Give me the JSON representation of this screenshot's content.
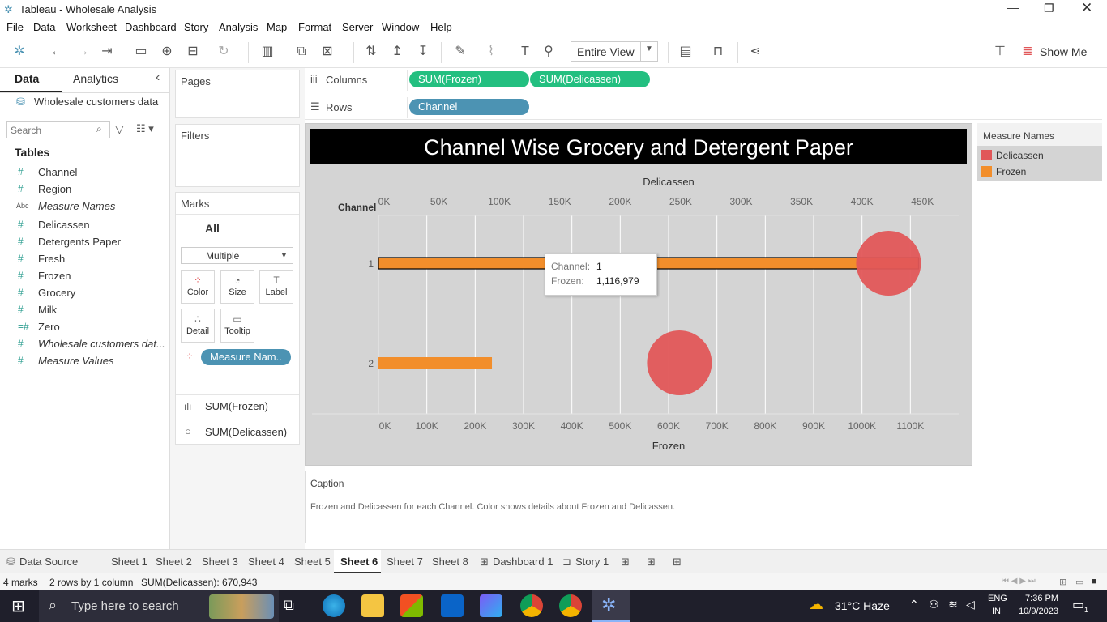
{
  "app": {
    "title": "Tableau - Wholesale Analysis"
  },
  "menu": [
    "File",
    "Data",
    "Worksheet",
    "Dashboard",
    "Story",
    "Analysis",
    "Map",
    "Format",
    "Server",
    "Window",
    "Help"
  ],
  "toolbar": {
    "view_mode": "Entire View",
    "show_me": "Show Me"
  },
  "left_pane": {
    "tab_data": "Data",
    "tab_analytics": "Analytics",
    "datasource": "Wholesale customers data",
    "search_placeholder": "Search",
    "tables_header": "Tables",
    "fields": [
      {
        "icon": "#",
        "name": "Channel"
      },
      {
        "icon": "#",
        "name": "Region"
      },
      {
        "icon": "Abc",
        "name": "Measure Names"
      },
      {
        "icon": "#",
        "name": "Delicassen"
      },
      {
        "icon": "#",
        "name": "Detergents Paper"
      },
      {
        "icon": "#",
        "name": "Fresh"
      },
      {
        "icon": "#",
        "name": "Frozen"
      },
      {
        "icon": "#",
        "name": "Grocery"
      },
      {
        "icon": "#",
        "name": "Milk"
      },
      {
        "icon": "=#",
        "name": "Zero"
      },
      {
        "icon": "#",
        "name": "Wholesale customers dat..."
      },
      {
        "icon": "#",
        "name": "Measure Values"
      }
    ]
  },
  "cards": {
    "pages": "Pages",
    "filters": "Filters",
    "marks": "Marks",
    "marks_all": "All",
    "mark_type": "Multiple",
    "buttons": {
      "color": "Color",
      "size": "Size",
      "label": "Label",
      "detail": "Detail",
      "tooltip": "Tooltip"
    },
    "measure_pill": "Measure Nam..",
    "marks_frozen": "SUM(Frozen)",
    "marks_delicassen": "SUM(Delicassen)"
  },
  "shelves": {
    "columns_label": "Columns",
    "rows_label": "Rows",
    "columns_pills": [
      "SUM(Frozen)",
      "SUM(Delicassen)"
    ],
    "rows_pills": [
      "Channel"
    ]
  },
  "viz": {
    "title": "Channel Wise Grocery and Detergent Paper",
    "row_header": "Channel",
    "top_axis_title": "Delicassen",
    "bottom_axis_title": "Frozen",
    "tooltip": {
      "channel_label": "Channel:",
      "channel_value": "1",
      "frozen_label": "Frozen:",
      "frozen_value": "1,116,979"
    }
  },
  "chart_data": {
    "type": "bar",
    "title": "Channel Wise Grocery and Detergent Paper",
    "categories": [
      "1",
      "2"
    ],
    "xlabel": "Frozen",
    "x2label": "Delicassen",
    "ylabel": "Channel",
    "series": [
      {
        "name": "Frozen",
        "mark": "bar",
        "color": "#f28e2b",
        "values": [
          1116979,
          234671
        ],
        "axis": "bottom",
        "xlim": [
          0,
          1200000
        ]
      },
      {
        "name": "Delicassen",
        "mark": "circle",
        "color": "#e15759",
        "values": [
          421955,
          248988
        ],
        "axis": "top",
        "xlim": [
          0,
          480000
        ]
      }
    ],
    "bottom_ticks": [
      "0K",
      "100K",
      "200K",
      "300K",
      "400K",
      "500K",
      "600K",
      "700K",
      "800K",
      "900K",
      "1000K",
      "1100K"
    ],
    "top_ticks": [
      "0K",
      "50K",
      "100K",
      "150K",
      "200K",
      "250K",
      "300K",
      "350K",
      "400K",
      "450K"
    ],
    "grid": true,
    "legend_position": "right"
  },
  "legend": {
    "title": "Measure Names",
    "items": [
      {
        "label": "Delicassen",
        "color": "#e15759"
      },
      {
        "label": "Frozen",
        "color": "#f28e2b"
      }
    ]
  },
  "caption": {
    "title": "Caption",
    "text": "Frozen and Delicassen for each Channel.  Color shows details about Frozen and Delicassen."
  },
  "sheet_tabs": {
    "datasource": "Data Source",
    "sheets": [
      "Sheet 1",
      "Sheet 2",
      "Sheet 3",
      "Sheet 4",
      "Sheet 5",
      "Sheet 6",
      "Sheet 7",
      "Sheet 8",
      "Dashboard 1",
      "Story 1"
    ],
    "active": "Sheet 6"
  },
  "status": {
    "marks": "4 marks",
    "rows_cols": "2 rows by 1 column",
    "sum": "SUM(Delicassen): 670,943"
  },
  "taskbar": {
    "search_placeholder": "Type here to search",
    "weather": "31°C  Haze",
    "lang_top": "ENG",
    "lang_bottom": "IN",
    "time": "7:36 PM",
    "date": "10/9/2023",
    "notif_count": "1"
  }
}
